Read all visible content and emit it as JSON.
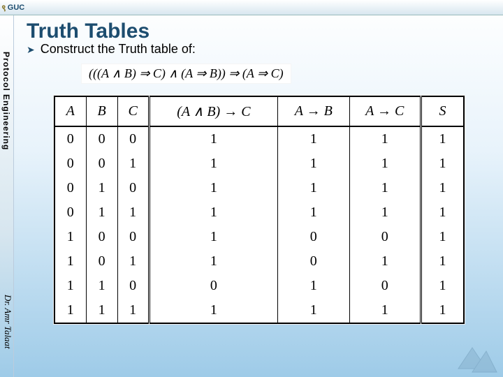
{
  "branding": {
    "logo_text": "GUC"
  },
  "sidebar": {
    "course_label": "Protocol Engineering",
    "author_label": "Dr. Amr Talaat"
  },
  "slide": {
    "title": "Truth Tables",
    "bullet_arrow": "➤",
    "bullet_text": "Construct the Truth table of:",
    "formula": "(((A ∧ B) ⇒ C) ∧ (A ⇒ B)) ⇒ (A ⇒ C)"
  },
  "table": {
    "headers": {
      "A": "A",
      "B": "B",
      "C": "C",
      "expr": "(A ∧ B) → C",
      "AB": "A → B",
      "AC": "A → C",
      "S": "S"
    },
    "rows": [
      {
        "A": "0",
        "B": "0",
        "C": "0",
        "expr": "1",
        "AB": "1",
        "AC": "1",
        "S": "1"
      },
      {
        "A": "0",
        "B": "0",
        "C": "1",
        "expr": "1",
        "AB": "1",
        "AC": "1",
        "S": "1"
      },
      {
        "A": "0",
        "B": "1",
        "C": "0",
        "expr": "1",
        "AB": "1",
        "AC": "1",
        "S": "1"
      },
      {
        "A": "0",
        "B": "1",
        "C": "1",
        "expr": "1",
        "AB": "1",
        "AC": "1",
        "S": "1"
      },
      {
        "A": "1",
        "B": "0",
        "C": "0",
        "expr": "1",
        "AB": "0",
        "AC": "0",
        "S": "1"
      },
      {
        "A": "1",
        "B": "0",
        "C": "1",
        "expr": "1",
        "AB": "0",
        "AC": "1",
        "S": "1"
      },
      {
        "A": "1",
        "B": "1",
        "C": "0",
        "expr": "0",
        "AB": "1",
        "AC": "0",
        "S": "1"
      },
      {
        "A": "1",
        "B": "1",
        "C": "1",
        "expr": "1",
        "AB": "1",
        "AC": "1",
        "S": "1"
      }
    ]
  }
}
